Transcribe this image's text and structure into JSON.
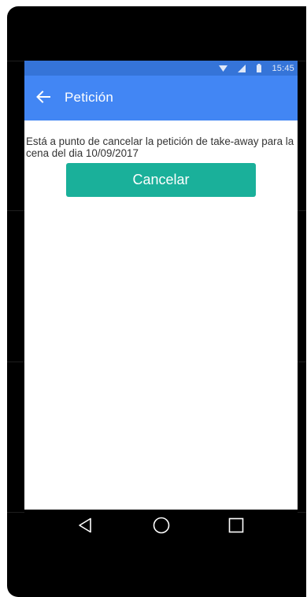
{
  "status_bar": {
    "time": "15:45",
    "icons": [
      "wifi-icon",
      "cell-signal-icon",
      "battery-icon"
    ]
  },
  "app_bar": {
    "back_icon": "arrow-left-icon",
    "title": "Petición"
  },
  "content": {
    "message": "Está a punto de cancelar la petición de take-away para la cena del dia 10/09/2017",
    "cancel_button": "Cancelar"
  },
  "nav_bar": {
    "buttons": [
      "back-triangle-icon",
      "home-circle-icon",
      "recents-square-icon"
    ]
  },
  "colors": {
    "status_bar": "#3574d8",
    "app_bar": "#4286f4",
    "button": "#1ab09a",
    "text": "#333333",
    "device": "#000000"
  }
}
